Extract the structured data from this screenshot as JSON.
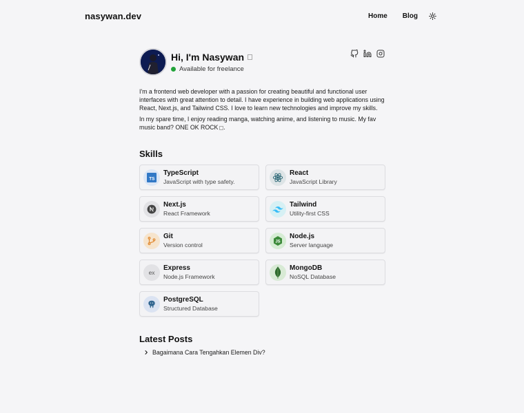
{
  "header": {
    "brand": "nasywan.dev",
    "nav": {
      "home": "Home",
      "blog": "Blog"
    },
    "theme_icon": "sun-icon"
  },
  "profile": {
    "greeting": "Hi, I'm Nasywan",
    "status": "Available for freelance",
    "status_color": "#22a33a",
    "socials": [
      "github-icon",
      "linkedin-icon",
      "instagram-icon"
    ]
  },
  "bio": {
    "p1": "I'm a frontend web developer with a passion for creating beautiful and functional user interfaces with great attention to detail. I have experience in building web applications using React, Next.js, and Tailwind CSS. I love to learn new technologies and improve my skills.",
    "p2": "In my spare time, I enjoy reading manga, watching anime, and listening to music. My fav music band? ONE OK ROCK",
    "p2_end": "."
  },
  "skills": {
    "title": "Skills",
    "items": [
      {
        "name": "TypeScript",
        "desc": "JavaScript with type safety.",
        "icon": "typescript-icon"
      },
      {
        "name": "React",
        "desc": "JavaScript Library",
        "icon": "react-icon"
      },
      {
        "name": "Next.js",
        "desc": "React Framework",
        "icon": "nextjs-icon"
      },
      {
        "name": "Tailwind",
        "desc": "Utility-first CSS",
        "icon": "tailwind-icon"
      },
      {
        "name": "Git",
        "desc": "Version control",
        "icon": "git-icon"
      },
      {
        "name": "Node.js",
        "desc": "Server language",
        "icon": "nodejs-icon"
      },
      {
        "name": "Express",
        "desc": "Node.js Framework",
        "icon": "express-icon"
      },
      {
        "name": "MongoDB",
        "desc": "NoSQL Database",
        "icon": "mongodb-icon"
      },
      {
        "name": "PostgreSQL",
        "desc": "Structured Database",
        "icon": "postgresql-icon"
      }
    ]
  },
  "posts": {
    "title": "Latest Posts",
    "items": [
      {
        "title": "Bagaimana Cara Tengahkan Elemen Div?"
      }
    ]
  }
}
